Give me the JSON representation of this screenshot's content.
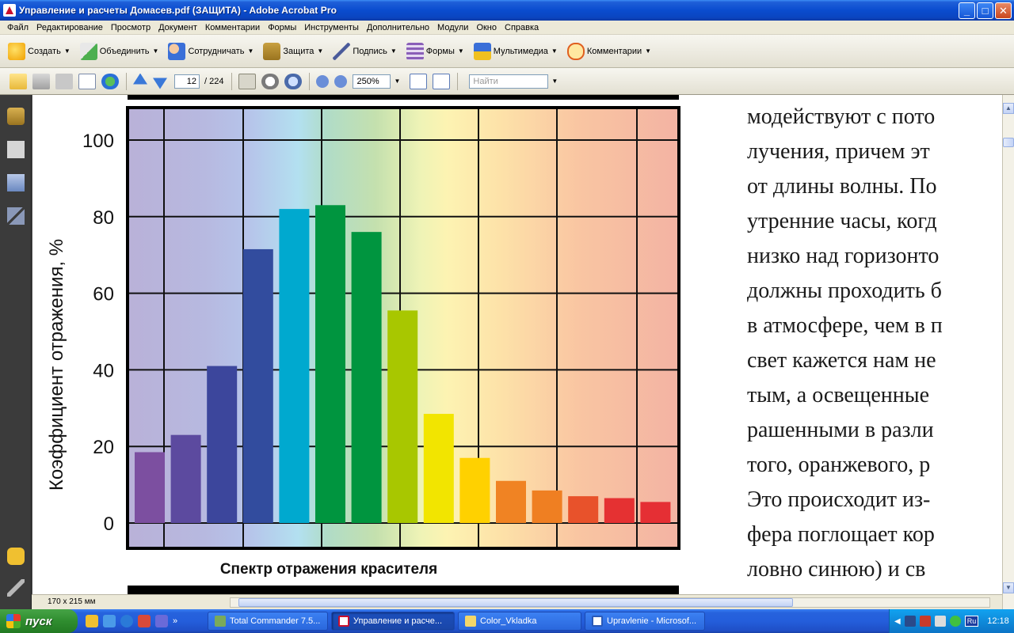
{
  "window": {
    "title": "Управление и расчеты Домасев.pdf (ЗАЩИТА) - Adobe Acrobat Pro"
  },
  "menu": [
    "Файл",
    "Редактирование",
    "Просмотр",
    "Документ",
    "Комментарии",
    "Формы",
    "Инструменты",
    "Дополнительно",
    "Модули",
    "Окно",
    "Справка"
  ],
  "toolbar": {
    "create": "Создать",
    "combine": "Объединить",
    "collaborate": "Сотрудничать",
    "protect": "Защита",
    "sign": "Подпись",
    "forms": "Формы",
    "multimedia": "Мультимедиа",
    "comment": "Комментарии"
  },
  "nav": {
    "page_current": "12",
    "page_total": "/ 224",
    "zoom": "250%",
    "find_placeholder": "Найти"
  },
  "status": {
    "page_size": "170 x 215 мм"
  },
  "chart_data": {
    "type": "bar",
    "title": "Спектр отражения красителя",
    "ylabel": "Коэффициент отражения, %",
    "xlabel": "",
    "ylim": [
      0,
      100
    ],
    "yticks": [
      "0",
      "20",
      "40",
      "60",
      "80",
      "100"
    ],
    "grid": true,
    "values": [
      18.5,
      23,
      41,
      71.5,
      82,
      83,
      76,
      55.5,
      28.5,
      17,
      11,
      8.5,
      7,
      6.5,
      5.5
    ],
    "colors": [
      "#7c4fa0",
      "#5c4a9f",
      "#3c469c",
      "#324c9e",
      "#00a9cf",
      "#00953f",
      "#00953f",
      "#a8c700",
      "#f2e500",
      "#ffd100",
      "#f08323",
      "#ef7f22",
      "#e8522b",
      "#e53132",
      "#e52f34"
    ]
  },
  "document_text": [
    "модействуют с пото",
    "лучения, причем эт",
    "от длины волны. По",
    "утренние часы, когд",
    "низко над горизонто",
    "должны проходить б",
    "в атмосфере, чем в п",
    "свет кажется нам не",
    "тым, а освещенные",
    "рашенными в разли",
    "того, оранжевого, р",
    "Это происходит из-",
    "фера поглощает кор",
    "ловно синюю) и св"
  ],
  "taskbar": {
    "start": "пуск",
    "tasks": [
      "Total Commander 7.5...",
      "Управление и расче...",
      "Color_Vkladka",
      "Upravlenie - Microsof..."
    ],
    "lang": "Ru",
    "clock": "12:18"
  }
}
